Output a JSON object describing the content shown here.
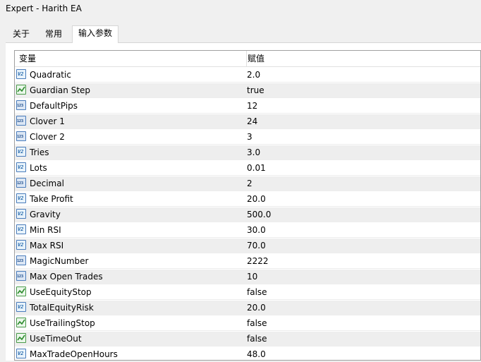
{
  "window": {
    "title": "Expert - Harith EA"
  },
  "tabs": [
    {
      "label": "关于"
    },
    {
      "label": "常用"
    },
    {
      "label": "输入参数"
    }
  ],
  "table": {
    "headers": {
      "variable": "变量",
      "value": "赋值"
    },
    "rows": [
      {
        "name": "Quadratic",
        "value": "2.0",
        "icon": "double-type-icon"
      },
      {
        "name": "Guardian Step",
        "value": "true",
        "icon": "bool-type-icon"
      },
      {
        "name": "DefaultPips",
        "value": "12",
        "icon": "int-type-icon"
      },
      {
        "name": "Clover 1",
        "value": "24",
        "icon": "int-type-icon"
      },
      {
        "name": "Clover 2",
        "value": "3",
        "icon": "int-type-icon"
      },
      {
        "name": "Tries",
        "value": "3.0",
        "icon": "double-type-icon"
      },
      {
        "name": "Lots",
        "value": "0.01",
        "icon": "double-type-icon"
      },
      {
        "name": "Decimal",
        "value": "2",
        "icon": "int-type-icon"
      },
      {
        "name": "Take Profit",
        "value": "20.0",
        "icon": "double-type-icon"
      },
      {
        "name": "Gravity",
        "value": "500.0",
        "icon": "double-type-icon"
      },
      {
        "name": "Min RSI",
        "value": "30.0",
        "icon": "double-type-icon"
      },
      {
        "name": "Max RSI",
        "value": "70.0",
        "icon": "double-type-icon"
      },
      {
        "name": "MagicNumber",
        "value": "2222",
        "icon": "int-type-icon"
      },
      {
        "name": "Max Open Trades",
        "value": "10",
        "icon": "int-type-icon"
      },
      {
        "name": "UseEquityStop",
        "value": "false",
        "icon": "bool-type-icon"
      },
      {
        "name": "TotalEquityRisk",
        "value": "20.0",
        "icon": "double-type-icon"
      },
      {
        "name": "UseTrailingStop",
        "value": "false",
        "icon": "bool-type-icon"
      },
      {
        "name": "UseTimeOut",
        "value": "false",
        "icon": "bool-type-icon"
      },
      {
        "name": "MaxTradeOpenHours",
        "value": "48.0",
        "icon": "double-type-icon"
      }
    ]
  }
}
